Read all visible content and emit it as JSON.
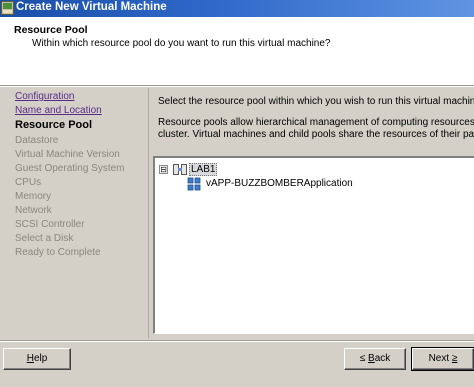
{
  "window": {
    "title": "Create New Virtual Machine"
  },
  "header": {
    "title": "Resource Pool",
    "subtitle": "Within which resource pool do you want to run this virtual machine?"
  },
  "steps": [
    {
      "label": "Configuration",
      "state": "link"
    },
    {
      "label": "Name and Location",
      "state": "link"
    },
    {
      "label": "Resource Pool",
      "state": "current"
    },
    {
      "label": "Datastore",
      "state": "disabled"
    },
    {
      "label": "Virtual Machine Version",
      "state": "disabled"
    },
    {
      "label": "Guest Operating System",
      "state": "disabled"
    },
    {
      "label": "CPUs",
      "state": "disabled"
    },
    {
      "label": "Memory",
      "state": "disabled"
    },
    {
      "label": "Network",
      "state": "disabled"
    },
    {
      "label": "SCSI Controller",
      "state": "disabled"
    },
    {
      "label": "Select a Disk",
      "state": "disabled"
    },
    {
      "label": "Ready to Complete",
      "state": "disabled"
    }
  ],
  "content": {
    "instruction": "Select the resource pool within which you wish to run this virtual machine.",
    "description_line1": "Resource pools allow hierarchical management of computing resources with",
    "description_line2": "cluster. Virtual machines and child pools share the resources of their paren"
  },
  "tree": {
    "root": {
      "label": "LAB1",
      "expander": "⊟"
    },
    "child": {
      "label": "vAPP-BUZZBOMBERApplication"
    }
  },
  "buttons": {
    "help": {
      "prefix": "",
      "underline": "H",
      "rest": "elp"
    },
    "back": {
      "prefix": "≤ ",
      "underline": "B",
      "rest": "ack"
    },
    "next": {
      "prefix": "Next ",
      "underline": "≥",
      "rest": ""
    }
  },
  "colors": {
    "titlebar_start": "#1a4fa8",
    "titlebar_end": "#5f95e2",
    "link_step": "#5a2a88",
    "disabled_step": "#8a877f",
    "dialog_bg": "#d4d0c8"
  }
}
